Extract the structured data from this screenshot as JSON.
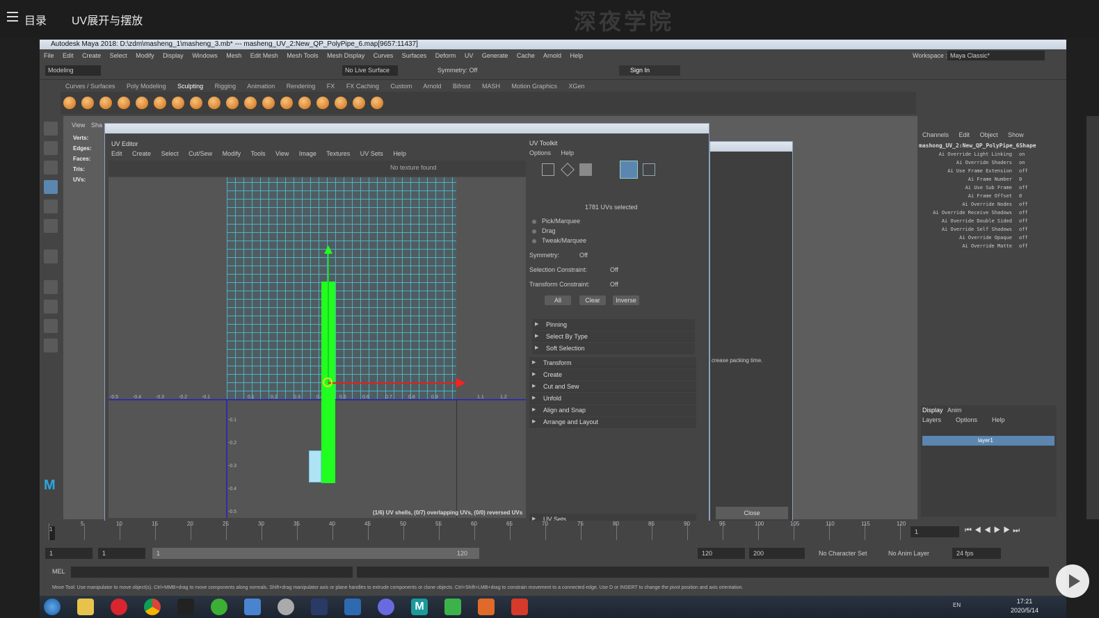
{
  "top": {
    "toc": "目录",
    "lesson": "UV展开与摆放",
    "watermark": "深夜学院"
  },
  "maya": {
    "title": "Autodesk Maya 2018: D:\\zdm\\masheng_1\\masheng_3.mb*  ---  masheng_UV_2:New_QP_PolyPipe_6.map[9657:11437]",
    "menus": [
      "File",
      "Edit",
      "Create",
      "Select",
      "Modify",
      "Display",
      "Windows",
      "Mesh",
      "Edit Mesh",
      "Mesh Tools",
      "Mesh Display",
      "Curves",
      "Surfaces",
      "Deform",
      "UV",
      "Generate",
      "Cache",
      "Arnold",
      "Help"
    ],
    "workspace_label": "Workspace :",
    "workspace_value": "Maya Classic*",
    "mode": "Modeling",
    "live_surface": "No Live Surface",
    "symmetry": "Symmetry: Off",
    "sign_in": "Sign In",
    "shelf_tabs": [
      "Curves / Surfaces",
      "Poly Modeling",
      "Sculpting",
      "Rigging",
      "Animation",
      "Rendering",
      "FX",
      "FX Caching",
      "Custom",
      "Arnold",
      "Bifrost",
      "MASH",
      "Motion Graphics",
      "XGen"
    ],
    "active_shelf": "Sculpting"
  },
  "hud": {
    "verts": "Verts:",
    "edges": "Edges:",
    "faces": "Faces:",
    "tris": "Tris:",
    "uvs": "UVs:",
    "view": "View",
    "shading": "Sha"
  },
  "uv_editor": {
    "title": "UV Editor",
    "menus": [
      "Edit",
      "Create",
      "Select",
      "Cut/Sew",
      "Modify",
      "Tools",
      "View",
      "Image",
      "Textures",
      "UV Sets",
      "Help"
    ],
    "no_texture": "No texture found",
    "status": "(1/6) UV shells, (0/7) overlapping UVs, (0/0) reversed UVs",
    "x_ticks": [
      "-0.5",
      "-0.4",
      "-0.3",
      "-0.2",
      "-0.1",
      "0.1",
      "0.2",
      "0.3",
      "0.4",
      "0.5",
      "0.6",
      "0.7",
      "0.8",
      "0.9",
      "1.1",
      "1.2"
    ],
    "y_ticks": [
      "-0.1",
      "-0.2",
      "-0.3",
      "-0.4",
      "-0.5"
    ]
  },
  "toolkit": {
    "title": "UV Toolkit",
    "menus": [
      "Options",
      "Help"
    ],
    "selected": "1781 UVs selected",
    "modes": [
      "Pick/Marquee",
      "Drag",
      "Tweak/Marquee"
    ],
    "symmetry_label": "Symmetry:",
    "symmetry_value": "Off",
    "sel_constraint_label": "Selection Constraint:",
    "sel_constraint_value": "Off",
    "transform_constraint_label": "Transform Constraint:",
    "transform_constraint_value": "Off",
    "buttons": [
      "All",
      "Clear",
      "Inverse"
    ],
    "sub_sections": [
      "Pinning",
      "Select By Type",
      "Soft Selection"
    ],
    "sections": [
      "Transform",
      "Create",
      "Cut and Sew",
      "Unfold",
      "Align and Snap",
      "Arrange and Layout"
    ],
    "uv_sets": "UV Sets"
  },
  "second_window": {
    "packing_text": "crease packing time.",
    "close": "Close"
  },
  "channel_box": {
    "tabs": [
      "Channels",
      "Edit",
      "Object",
      "Show"
    ],
    "object": "mashong_UV_2:New_QP_PolyPipe_6Shape",
    "attrs": [
      {
        "name": "Ai Override Light Linking",
        "value": "on"
      },
      {
        "name": "Ai Override Shaders",
        "value": "on"
      },
      {
        "name": "Ai Use Frame Extension",
        "value": "off"
      },
      {
        "name": "Ai Frame Number",
        "value": "0"
      },
      {
        "name": "Ai Use Sub Frame",
        "value": "off"
      },
      {
        "name": "Ai Frame Offset",
        "value": "0"
      },
      {
        "name": "Ai Override Nodes",
        "value": "off"
      },
      {
        "name": "Ai Override Receive Shadows",
        "value": "off"
      },
      {
        "name": "Ai Override Double Sided",
        "value": "off"
      },
      {
        "name": "Ai Override Self Shadows",
        "value": "off"
      },
      {
        "name": "Ai Override Opaque",
        "value": "off"
      },
      {
        "name": "Ai Override Matte",
        "value": "off"
      }
    ],
    "layer_tabs": [
      "Display",
      "Anim"
    ],
    "layer_menus": [
      "Layers",
      "Options",
      "Help"
    ],
    "layer_name": "layer1"
  },
  "timeline": {
    "labels": [
      "5",
      "10",
      "15",
      "20",
      "25",
      "30",
      "35",
      "40",
      "45",
      "50",
      "55",
      "60",
      "65",
      "70",
      "75",
      "80",
      "85",
      "90",
      "95",
      "100",
      "105",
      "110",
      "115",
      "120"
    ],
    "current": "1",
    "start": "1",
    "start2": "1",
    "range_start": "1",
    "range_end": "120",
    "end": "120",
    "max": "200",
    "character_set": "No Character Set",
    "anim_layer": "No Anim Layer",
    "fps": "24 fps"
  },
  "mel": {
    "label": "MEL"
  },
  "help_line": "Move Tool: Use manipulator to move object(s). Ctrl+MMB+drag to move components along normals. Shift+drag manipulator axis or plane handles to extrude components or clone objects. Ctrl+Shift+LMB+drag to constrain movement to a connected edge. Use D or INSERT to change the pivot position and axis orientation.",
  "taskbar": {
    "time": "17:21",
    "date": "2020/5/14",
    "lang": "EN"
  },
  "colors": {
    "shell": "#20ff20",
    "grid_lines": "#50c8e6",
    "selection_blue": "#5a86b0"
  }
}
